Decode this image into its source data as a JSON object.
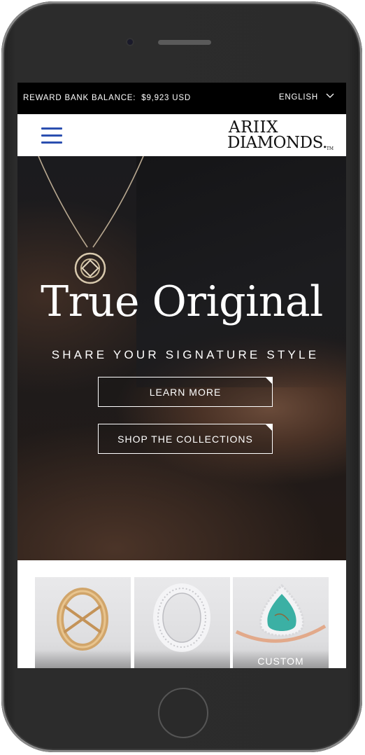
{
  "topbar": {
    "balance_label": "REWARD BANK BALANCE:",
    "balance_value": "$9,923 USD",
    "language": "ENGLISH"
  },
  "header": {
    "logo_line1": "ARIIX",
    "logo_line2": "DIAMONDS.",
    "logo_tm": "TM"
  },
  "hero": {
    "title": "True Original",
    "subtitle": "SHARE YOUR SIGNATURE STYLE",
    "learn_more": "LEARN MORE",
    "shop": "SHOP THE COLLECTIONS"
  },
  "products": [
    {
      "label": ""
    },
    {
      "label": ""
    },
    {
      "label": "CUSTOM"
    }
  ],
  "colors": {
    "accent": "#2b4fb0",
    "topbar_bg": "#000000"
  }
}
